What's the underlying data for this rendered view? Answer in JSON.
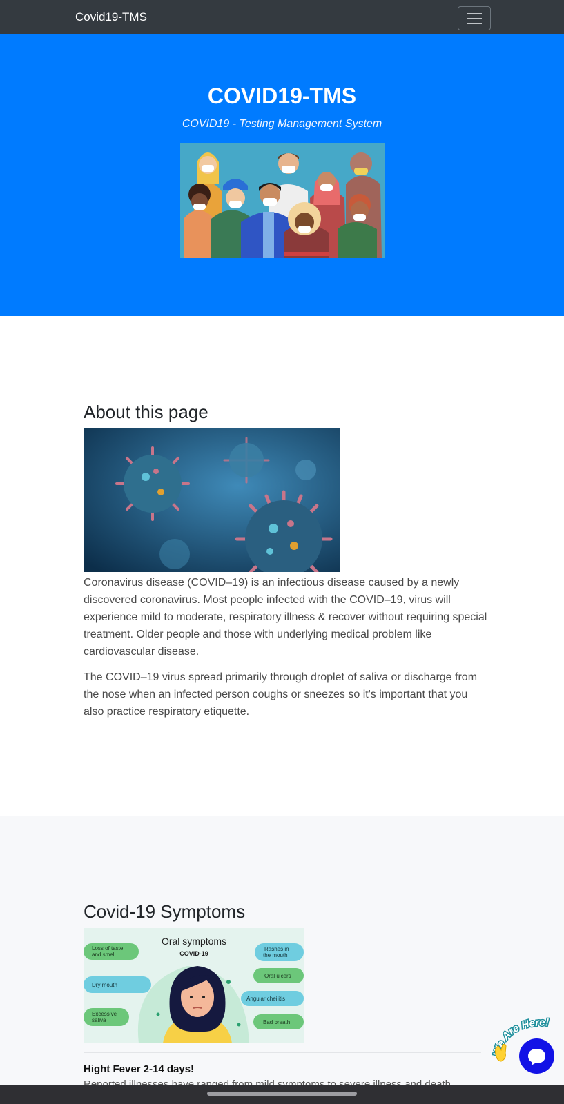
{
  "navbar": {
    "brand": "Covid19-TMS",
    "toggler_icon": "hamburger-icon"
  },
  "hero": {
    "title": "COVID19-TMS",
    "subtitle": "COVID19 - Testing Management System",
    "image_icon": "masked-people-illustration"
  },
  "about": {
    "heading": "About this page",
    "image_icon": "coronavirus-illustration",
    "paragraphs": [
      "Coronavirus disease (COVID–19) is an infectious disease caused by a newly discovered coronavirus. Most people infected with the COVID–19, virus will experience mild to moderate, respiratory illness & recover without requiring special treatment. Older people and those with underlying medical problem like cardiovascular disease.",
      "The COVID–19 virus spread primarily through droplet of saliva or discharge from the nose when an infected person coughs or sneezes so it's important that you also practice respiratory etiquette."
    ]
  },
  "symptoms": {
    "heading": "Covid-19 Symptoms",
    "image": {
      "title": "Oral symptoms",
      "subtitle": "COVID-19",
      "left_labels": [
        "Loss of taste and smell",
        "Dry mouth",
        "Excessive saliva"
      ],
      "right_labels": [
        "Rashes in the mouth",
        "Oral ulcers",
        "Angular cheilitis",
        "Bad breath"
      ]
    },
    "items": [
      {
        "title": "Hight Fever 2-14 days!",
        "description": "Reported illnesses have ranged from mild symptoms to severe illness and death"
      }
    ]
  },
  "chat": {
    "badge_text": "We Are Here!",
    "badge_icon": "waving-hand-icon",
    "button_icon": "chat-bubble-icon"
  },
  "colors": {
    "navbar": "#343a40",
    "hero": "#007bff",
    "chat_button": "#1212e6"
  }
}
